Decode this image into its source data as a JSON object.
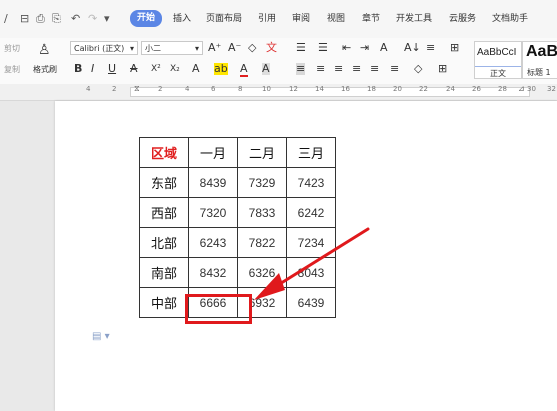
{
  "quick_access": [
    "⊟",
    "⎙",
    "⎘",
    "↶",
    "↷",
    "▾"
  ],
  "tabs": [
    "开始",
    "插入",
    "页面布局",
    "引用",
    "审阅",
    "视图",
    "章节",
    "开发工具",
    "云服务",
    "文档助手"
  ],
  "active_tab": "开始",
  "clipboard": {
    "cut_label": "剪切",
    "copy_label": "复制",
    "format_painter_label": "格式刷"
  },
  "font": {
    "name": "Calibri (正文)",
    "size": "小二"
  },
  "font_buttons": {
    "grow": "A⁺",
    "shrink": "A⁻",
    "clear": "◇",
    "pinyin": "文"
  },
  "format_row": [
    "B",
    "I",
    "U",
    "A",
    "X²",
    "X₂",
    "A",
    "ab",
    "A",
    "A"
  ],
  "paragraph_row1": [
    "☰",
    "☰",
    "⇤",
    "⇥",
    "A",
    "A↓",
    "≡",
    "⊞"
  ],
  "paragraph_row2": [
    "≡",
    "≡",
    "≡",
    "≡",
    "≡",
    "≡",
    "◇",
    "⊞"
  ],
  "styles": [
    {
      "preview": "AaBbCcI",
      "name": "正文"
    },
    {
      "preview": "AaB",
      "name": "标题 1"
    }
  ],
  "ruler": [
    "4",
    "2",
    "2",
    "4",
    "6",
    "8",
    "10",
    "12",
    "14",
    "16",
    "18",
    "20",
    "22",
    "24",
    "26",
    "28",
    "30",
    "32"
  ],
  "table": {
    "header": [
      "区域",
      "一月",
      "二月",
      "三月"
    ],
    "rows": [
      [
        "东部",
        "8439",
        "7329",
        "7423"
      ],
      [
        "西部",
        "7320",
        "7833",
        "6242"
      ],
      [
        "北部",
        "6243",
        "7822",
        "7234"
      ],
      [
        "南部",
        "8432",
        "6326",
        "8043"
      ],
      [
        "中部",
        "6666",
        "6932",
        "6439"
      ]
    ]
  },
  "colors": {
    "active_tab": "#5b86e5",
    "header_red": "#e02020",
    "highlight_red": "#e0191c",
    "arrow_red": "#e0191c"
  },
  "paste_options_icon": "clipboard-icon"
}
